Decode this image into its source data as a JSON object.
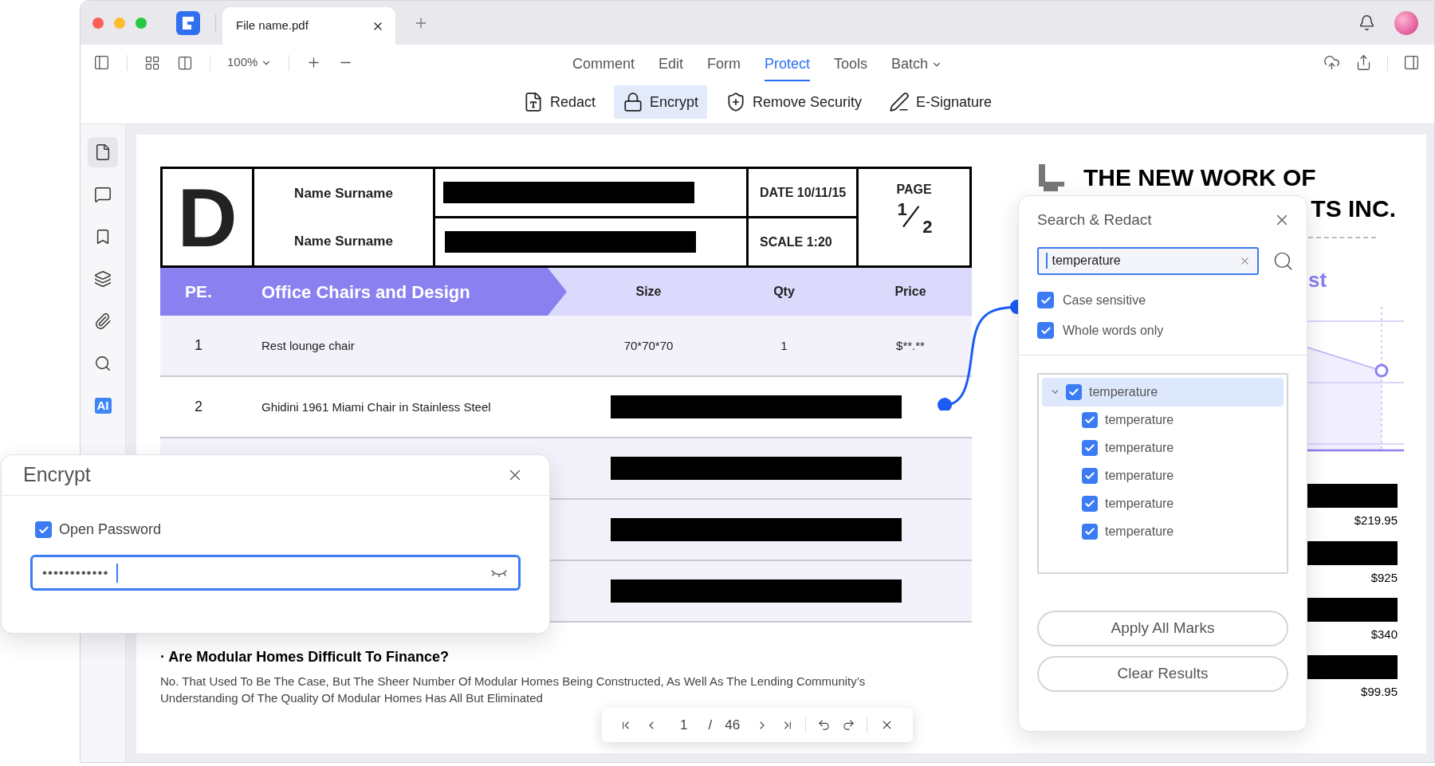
{
  "tab": {
    "title": "File name.pdf"
  },
  "toolbar": {
    "zoom": "100%",
    "menus": [
      {
        "label": "Comment",
        "selected": false,
        "kind": "plain"
      },
      {
        "label": "Edit",
        "selected": false,
        "kind": "plain"
      },
      {
        "label": "Form",
        "selected": false,
        "kind": "plain"
      },
      {
        "label": "Protect",
        "selected": true,
        "kind": "plain"
      },
      {
        "label": "Tools",
        "selected": false,
        "kind": "plain"
      },
      {
        "label": "Batch",
        "selected": false,
        "kind": "dropdown"
      }
    ]
  },
  "subtools": [
    {
      "label": "Redact",
      "kind": "redact",
      "selected": false
    },
    {
      "label": "Encrypt",
      "kind": "encrypt",
      "selected": true
    },
    {
      "label": "Remove Security",
      "kind": "security",
      "selected": false
    },
    {
      "label": "E-Signature",
      "kind": "signature",
      "selected": false
    }
  ],
  "sidebar": {
    "items": [
      {
        "kind": "page",
        "selected": true
      },
      {
        "kind": "comment",
        "selected": false
      },
      {
        "kind": "bookmark",
        "selected": false
      },
      {
        "kind": "layers",
        "selected": false
      },
      {
        "kind": "attachment",
        "selected": false
      },
      {
        "kind": "search",
        "selected": false
      },
      {
        "kind": "ai",
        "label": "AI",
        "selected": false
      }
    ]
  },
  "document": {
    "logo_letter": "D",
    "names": [
      "Name Surname",
      "Name Surname"
    ],
    "date": "DATE 10/11/15",
    "scale": "SCALE 1:20",
    "page_label": "PAGE",
    "page_num": "1",
    "page_total": "2",
    "table": {
      "section": "PE.",
      "title": "Office Chairs and Design",
      "columns": [
        "Size",
        "Qty",
        "Price"
      ],
      "rows": [
        {
          "no": "1",
          "name": "Rest lounge chair",
          "size": "70*70*70",
          "qty": "1",
          "price": "$**.**",
          "redacted": false
        },
        {
          "no": "2",
          "name": "Ghidini 1961 Miami Chair in Stainless Steel",
          "redacted": true
        },
        {
          "redacted": true
        },
        {
          "redacted": true
        },
        {
          "redacted": true
        }
      ]
    },
    "question": "· Are Modular Homes Difficult To Finance?",
    "paragraph": "No. That Used To Be The Case, But The Sheer Number Of Modular Homes Being Constructed, As Well As The Lending Community’s Understanding Of The Quality Of Modular Homes Has All But Eliminated",
    "heading_lines": [
      "THE NEW WORK OF",
      "TS INC."
    ],
    "subheading": "st",
    "prices": [
      "$219.95",
      "$925",
      "$340",
      "$99.95"
    ]
  },
  "search_panel": {
    "title": "Search & Redact",
    "query": "temperature",
    "options": [
      {
        "label": "Case sensitive",
        "checked": true
      },
      {
        "label": "Whole words only",
        "checked": true
      }
    ],
    "results": {
      "label": "temperature",
      "checked": true,
      "expanded": true,
      "selected": true,
      "children": [
        {
          "label": "temperature",
          "checked": true
        },
        {
          "label": "temperature",
          "checked": true
        },
        {
          "label": "temperature",
          "checked": true
        },
        {
          "label": "temperature",
          "checked": true
        },
        {
          "label": "temperature",
          "checked": true
        }
      ]
    },
    "buttons": [
      "Apply All Marks",
      "Clear Results"
    ]
  },
  "encrypt": {
    "title": "Encrypt",
    "option": {
      "label": "Open Password",
      "checked": true
    },
    "password": "••••••••••••"
  },
  "page_nav": {
    "page": "1",
    "separator": "/",
    "total": "46"
  }
}
